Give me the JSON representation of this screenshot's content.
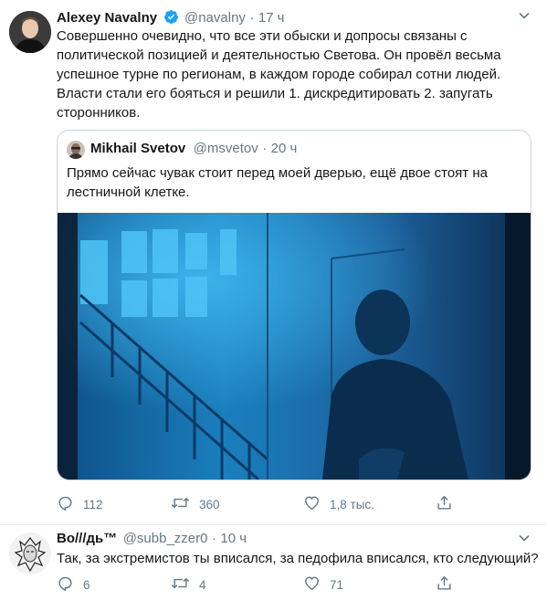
{
  "main_tweet": {
    "author_name": "Alexey Navalny",
    "handle": "@navalny",
    "separator": "·",
    "time": "17 ч",
    "text_lines": [
      "Совершенно очевидно, что все эти обыски и допросы связаны с",
      "политической позицией и деятельностью Светова. Он провёл весьма",
      "успешное турне по регионам, в каждом городе собирал сотни людей.",
      "Власти стали его бояться и решили 1. дискредитировать 2. запугать",
      "сторонников."
    ],
    "replies": "112",
    "retweets": "360",
    "likes": "1,8 тыс.",
    "icons": [
      "reply-icon",
      "retweet-icon",
      "like-icon",
      "share-icon",
      "verified-badge-icon",
      "caret-down-icon"
    ]
  },
  "quoted_tweet": {
    "author_name": "Mikhail Svetov",
    "handle": "@msvetov",
    "separator": "·",
    "time": "20 ч",
    "text_lines": [
      "Прямо сейчас чувак стоит перед моей дверью, ещё двое стоят на",
      "лестничной клетке."
    ]
  },
  "reply_tweet": {
    "author_name": "Bo///дь™",
    "handle": "@subb_zzer0",
    "separator": "·",
    "time": "10 ч",
    "text": "Так, за экстремистов ты вписался, за педофила вписался, кто следующий?",
    "replies": "6",
    "retweets": "4",
    "likes": "71"
  },
  "colors": {
    "text": "#14171a",
    "secondary": "#657786",
    "verified": "#1da1f2",
    "border": "#e6ecf0"
  }
}
